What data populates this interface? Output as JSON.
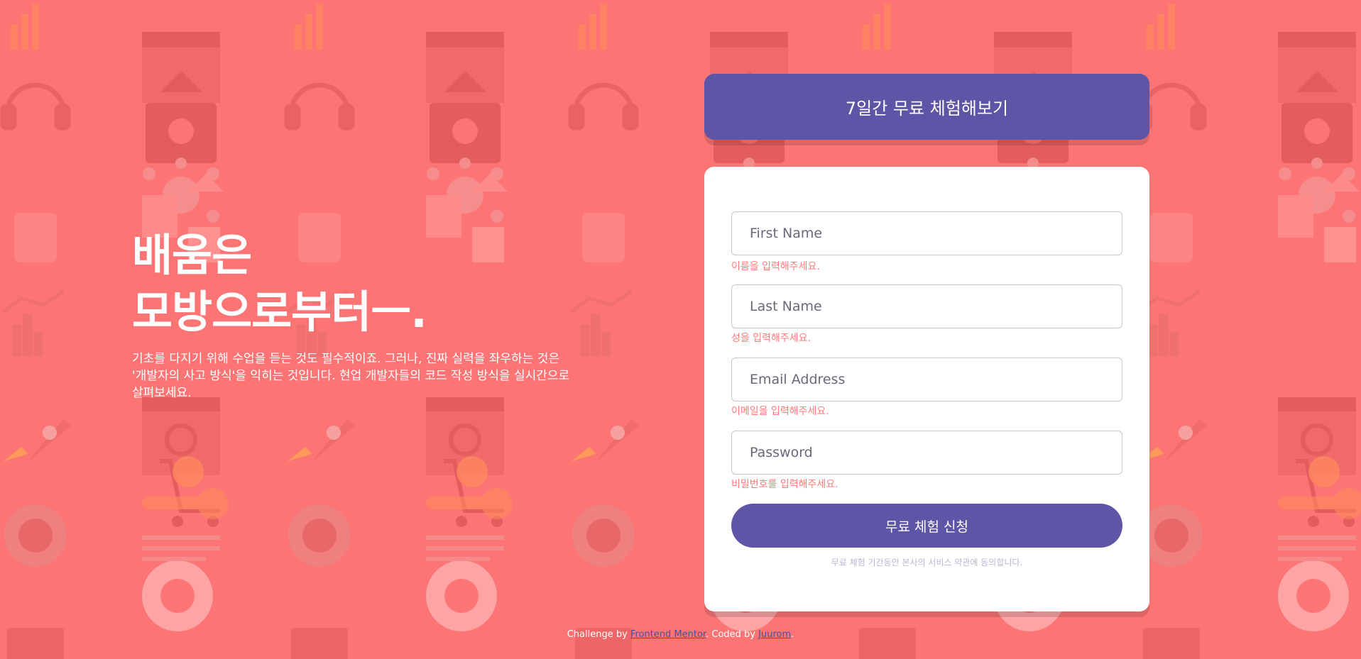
{
  "hero": {
    "title_line1": "배움은",
    "title_line2": "모방으로부터ㅡ.",
    "description": "기초를 다지기 위해 수업을 듣는 것도 필수적이죠. 그러나, 진짜 실력을 좌우하는 것은 '개발자의 사고 방식'을 익히는 것입니다. 현업 개발자들의 코드 작성 방식을 실시간으로 살펴보세요."
  },
  "banner": {
    "text": "7일간 무료 체험해보기"
  },
  "form": {
    "fields": [
      {
        "placeholder": "First Name",
        "error": "이름을 입력해주세요."
      },
      {
        "placeholder": "Last Name",
        "error": "성을 입력해주세요."
      },
      {
        "placeholder": "Email Address",
        "error": "이메일을 입력해주세요."
      },
      {
        "placeholder": "Password",
        "error": "비밀번호를 입력해주세요."
      }
    ],
    "submit_label": "무료 체험 신청",
    "terms": "무료 체험 기간동안 본사의 서비스 약관에 동의합니다."
  },
  "footer": {
    "prefix": "Challenge by ",
    "link1": "Frontend Mentor",
    "middle": ". Coded by ",
    "link2": "Juurom",
    "suffix": "."
  },
  "colors": {
    "background": "#fd7475",
    "accent": "#5f55a6",
    "error": "#ff7979"
  },
  "background_icons": [
    "headset-icon",
    "bar-chart-icon",
    "browser-window-icon",
    "toolbox-icon",
    "network-icon",
    "thumbs-up-icon",
    "shapes-icon",
    "line-chart-icon",
    "rocket-icon",
    "magnifier-icon",
    "cart-icon",
    "gear-icon",
    "globe-icon",
    "key-icon",
    "lifebuoy-icon",
    "calendar-icon"
  ]
}
